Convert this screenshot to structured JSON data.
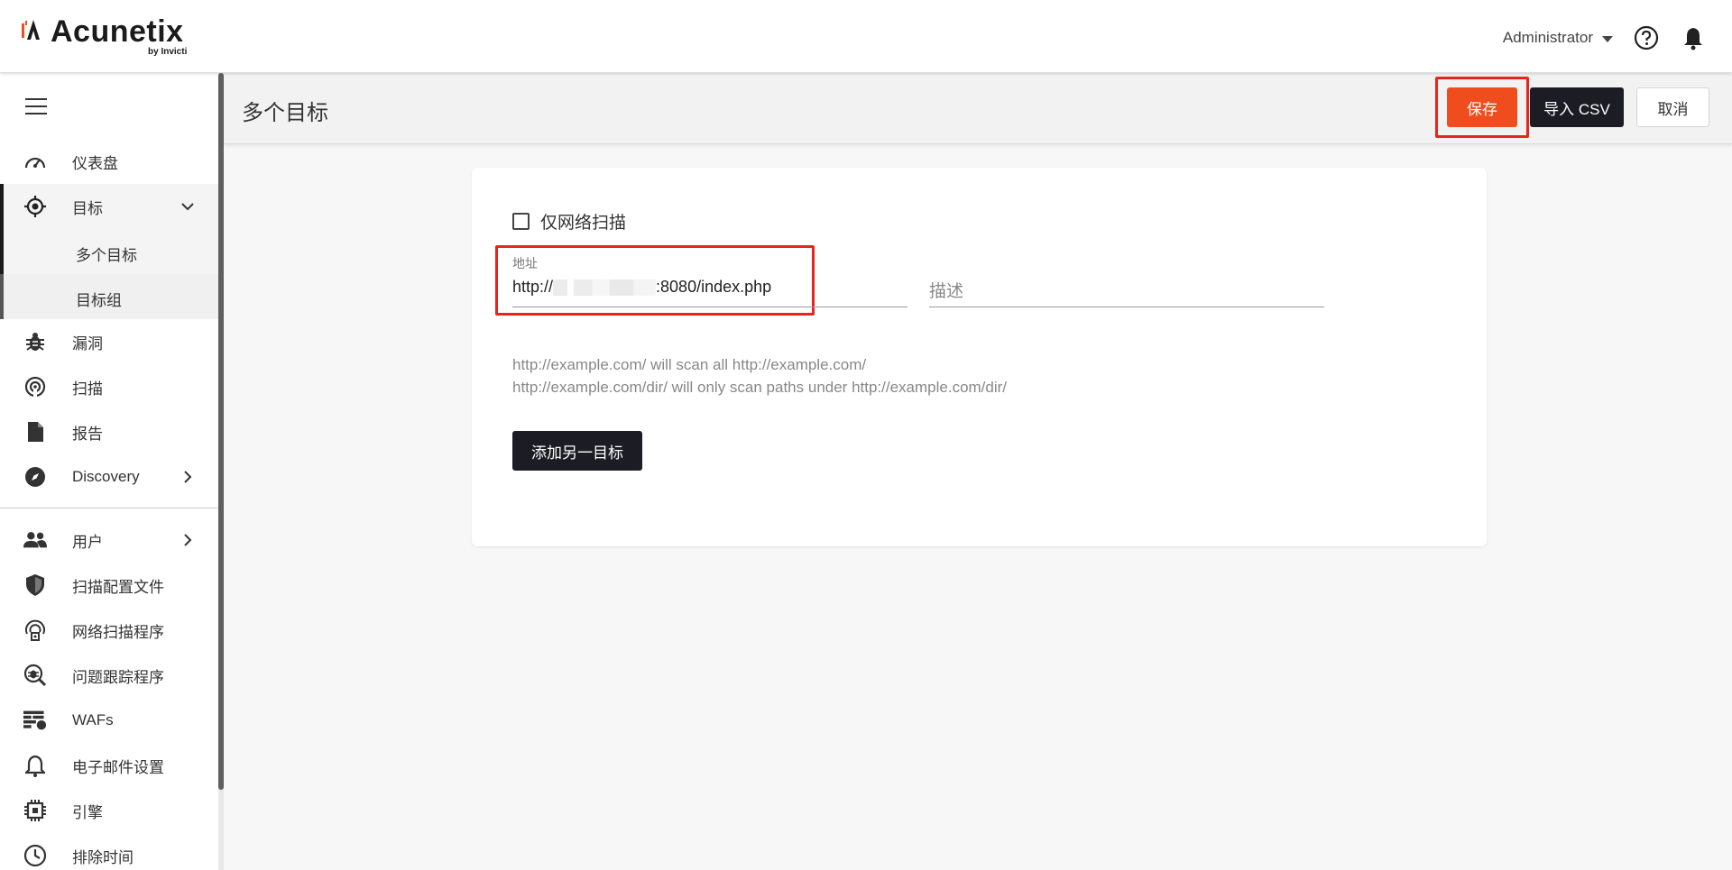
{
  "header": {
    "logo_text": "Acunetix",
    "logo_sub": "by Invicti",
    "user_label": "Administrator",
    "help_icon": "help-circle-icon",
    "bell_icon": "bell-icon"
  },
  "sidebar": {
    "items": [
      {
        "label": "仪表盘",
        "icon": "dashboard-icon"
      },
      {
        "label": "目标",
        "icon": "target-icon"
      },
      {
        "label": "漏洞",
        "icon": "bug-icon"
      },
      {
        "label": "扫描",
        "icon": "scan-icon"
      },
      {
        "label": "报告",
        "icon": "report-icon"
      },
      {
        "label": "Discovery",
        "icon": "compass-icon"
      },
      {
        "label": "用户",
        "icon": "users-icon"
      },
      {
        "label": "扫描配置文件",
        "icon": "shield-icon"
      },
      {
        "label": "网络扫描程序",
        "icon": "network-scanner-icon"
      },
      {
        "label": "问题跟踪程序",
        "icon": "issue-tracker-icon"
      },
      {
        "label": "WAFs",
        "icon": "firewall-icon"
      },
      {
        "label": "电子邮件设置",
        "icon": "bell-icon"
      },
      {
        "label": "引擎",
        "icon": "chip-icon"
      },
      {
        "label": "排除时间",
        "icon": "clock-icon"
      }
    ],
    "target_sub": [
      {
        "label": "多个目标"
      },
      {
        "label": "目标组"
      }
    ]
  },
  "page": {
    "title": "多个目标",
    "save_label": "保存",
    "import_csv_label": "导入 CSV",
    "cancel_label": "取消"
  },
  "form": {
    "network_only_label": "仅网络扫描",
    "network_only_checked": false,
    "address_label": "地址",
    "address_prefix": "http://",
    "address_suffix": ":8080/index.php",
    "description_placeholder": "描述",
    "help_line1": "http://example.com/ will scan all http://example.com/",
    "help_line2": "http://example.com/dir/ will only scan paths under http://example.com/dir/",
    "add_target_label": "添加另一目标"
  },
  "colors": {
    "accent": "#f04d1e",
    "dark_button": "#1c1c24",
    "highlight": "#e8241c"
  }
}
